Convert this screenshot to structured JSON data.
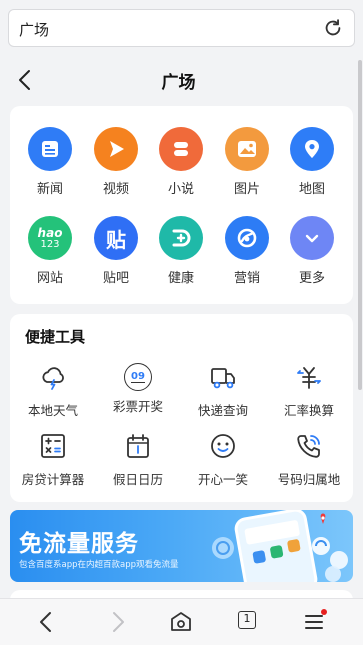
{
  "address_bar": {
    "text": "广场"
  },
  "header": {
    "title": "广场"
  },
  "apps": [
    {
      "label": "新闻",
      "color": "#2f7cf6",
      "icon": "news-icon"
    },
    {
      "label": "视频",
      "color": "#f5821f",
      "icon": "play-icon"
    },
    {
      "label": "小说",
      "color": "#f06a3a",
      "icon": "book-icon"
    },
    {
      "label": "图片",
      "color": "#f39a3e",
      "icon": "picture-icon"
    },
    {
      "label": "地图",
      "color": "#2e7df7",
      "icon": "map-pin-icon"
    },
    {
      "label": "网站",
      "color": "#24c27a",
      "icon": "hao123-icon",
      "icon_text": "hao",
      "icon_text2": "123"
    },
    {
      "label": "贴吧",
      "color": "#2f6ff5",
      "icon": "tieba-icon",
      "icon_text": "贴"
    },
    {
      "label": "健康",
      "color": "#1fb9a8",
      "icon": "health-icon"
    },
    {
      "label": "营销",
      "color": "#2d7cf5",
      "icon": "marketing-icon"
    },
    {
      "label": "更多",
      "color": "#6e86f5",
      "icon": "chevron-down-icon"
    }
  ],
  "tools": {
    "title": "便捷工具",
    "items": [
      {
        "label": "本地天气",
        "icon": "weather-icon"
      },
      {
        "label": "彩票开奖",
        "icon": "lottery-icon",
        "icon_text": "09"
      },
      {
        "label": "快递查询",
        "icon": "delivery-truck-icon"
      },
      {
        "label": "汇率换算",
        "icon": "currency-exchange-icon"
      },
      {
        "label": "房贷计算器",
        "icon": "calculator-icon"
      },
      {
        "label": "假日日历",
        "icon": "calendar-icon"
      },
      {
        "label": "开心一笑",
        "icon": "smile-icon"
      },
      {
        "label": "号码归属地",
        "icon": "phone-icon"
      }
    ]
  },
  "banner": {
    "title": "免流量服务",
    "subtitle": "包含百度系app在内超百款app观看免流量"
  },
  "bottom_nav": {
    "tab_count": "1"
  },
  "colors": {
    "accent_blue": "#2f7cf6",
    "background": "#f2f3f5",
    "notification_dot": "#e61f1f"
  }
}
